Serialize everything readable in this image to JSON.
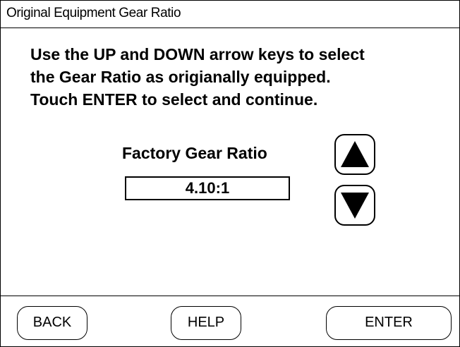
{
  "window": {
    "title": "Original Equipment Gear Ratio"
  },
  "instructions": {
    "line1": "Use the UP and DOWN arrow keys to select",
    "line2": "the Gear Ratio as origianally equipped.",
    "line3": "Touch ENTER to select and continue."
  },
  "gear_ratio": {
    "label": "Factory Gear Ratio",
    "value": "4.10:1"
  },
  "icons": {
    "up": "triangle-up-icon",
    "down": "triangle-down-icon"
  },
  "footer": {
    "back_label": "BACK",
    "help_label": "HELP",
    "enter_label": "ENTER"
  }
}
